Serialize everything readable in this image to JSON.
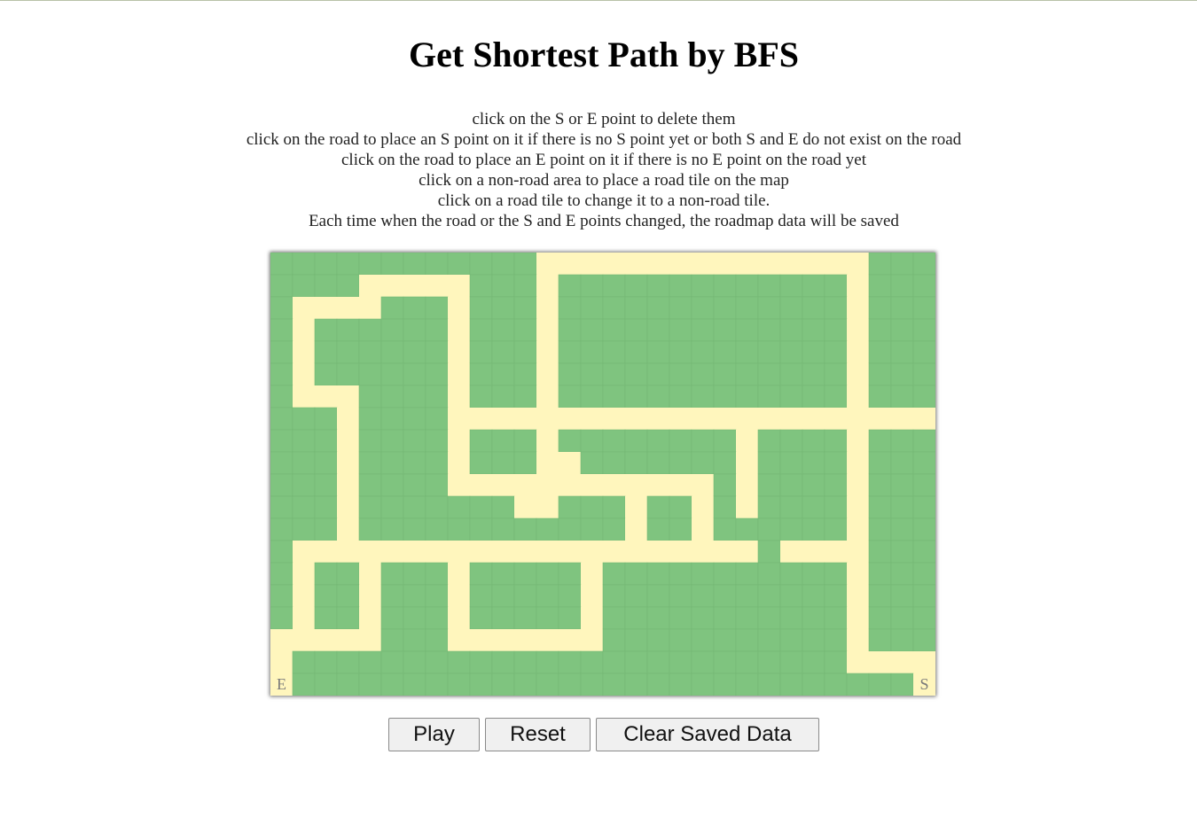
{
  "page": {
    "title": "Get Shortest Path by BFS"
  },
  "instructions": [
    "click on the S or E point to delete them",
    "click on the road to place an S point on it if there is no S point yet or both S and E do not exist on the road",
    "click on the road to place an E point on it if there is no E point on the road yet",
    "click on a non-road area to place a road tile on the map",
    "click on a road tile to change it to a non-road tile.",
    "Each time when the road or the S and E points changed, the roadmap data will be saved"
  ],
  "board": {
    "columns": 30,
    "rows": 20,
    "colors": {
      "grass": "#7fc47f",
      "road": "#fff6bd",
      "gridline": "#74b874"
    },
    "start_label": "S",
    "end_label": "E",
    "start_cell": [
      29,
      19
    ],
    "end_cell": [
      0,
      19
    ],
    "road_cells": [
      [
        12,
        0
      ],
      [
        13,
        0
      ],
      [
        14,
        0
      ],
      [
        15,
        0
      ],
      [
        16,
        0
      ],
      [
        17,
        0
      ],
      [
        18,
        0
      ],
      [
        19,
        0
      ],
      [
        20,
        0
      ],
      [
        21,
        0
      ],
      [
        22,
        0
      ],
      [
        23,
        0
      ],
      [
        24,
        0
      ],
      [
        25,
        0
      ],
      [
        26,
        0
      ],
      [
        4,
        1
      ],
      [
        5,
        1
      ],
      [
        6,
        1
      ],
      [
        7,
        1
      ],
      [
        8,
        1
      ],
      [
        12,
        1
      ],
      [
        26,
        1
      ],
      [
        1,
        2
      ],
      [
        2,
        2
      ],
      [
        3,
        2
      ],
      [
        4,
        2
      ],
      [
        8,
        2
      ],
      [
        12,
        2
      ],
      [
        26,
        2
      ],
      [
        1,
        3
      ],
      [
        8,
        3
      ],
      [
        12,
        3
      ],
      [
        26,
        3
      ],
      [
        1,
        4
      ],
      [
        8,
        4
      ],
      [
        12,
        4
      ],
      [
        26,
        4
      ],
      [
        1,
        5
      ],
      [
        8,
        5
      ],
      [
        12,
        5
      ],
      [
        26,
        5
      ],
      [
        1,
        6
      ],
      [
        2,
        6
      ],
      [
        3,
        6
      ],
      [
        8,
        6
      ],
      [
        12,
        6
      ],
      [
        26,
        6
      ],
      [
        3,
        7
      ],
      [
        8,
        7
      ],
      [
        9,
        7
      ],
      [
        10,
        7
      ],
      [
        11,
        7
      ],
      [
        12,
        7
      ],
      [
        13,
        7
      ],
      [
        14,
        7
      ],
      [
        15,
        7
      ],
      [
        16,
        7
      ],
      [
        17,
        7
      ],
      [
        18,
        7
      ],
      [
        19,
        7
      ],
      [
        20,
        7
      ],
      [
        21,
        7
      ],
      [
        22,
        7
      ],
      [
        23,
        7
      ],
      [
        24,
        7
      ],
      [
        25,
        7
      ],
      [
        26,
        7
      ],
      [
        27,
        7
      ],
      [
        28,
        7
      ],
      [
        29,
        7
      ],
      [
        3,
        8
      ],
      [
        8,
        8
      ],
      [
        12,
        8
      ],
      [
        21,
        8
      ],
      [
        26,
        8
      ],
      [
        3,
        9
      ],
      [
        8,
        9
      ],
      [
        12,
        9
      ],
      [
        13,
        9
      ],
      [
        21,
        9
      ],
      [
        26,
        9
      ],
      [
        3,
        10
      ],
      [
        8,
        10
      ],
      [
        9,
        10
      ],
      [
        10,
        10
      ],
      [
        11,
        10
      ],
      [
        12,
        10
      ],
      [
        13,
        10
      ],
      [
        14,
        10
      ],
      [
        15,
        10
      ],
      [
        16,
        10
      ],
      [
        17,
        10
      ],
      [
        18,
        10
      ],
      [
        19,
        10
      ],
      [
        21,
        10
      ],
      [
        26,
        10
      ],
      [
        3,
        11
      ],
      [
        11,
        11
      ],
      [
        12,
        11
      ],
      [
        16,
        11
      ],
      [
        19,
        11
      ],
      [
        21,
        11
      ],
      [
        26,
        11
      ],
      [
        3,
        12
      ],
      [
        16,
        12
      ],
      [
        19,
        12
      ],
      [
        26,
        12
      ],
      [
        1,
        13
      ],
      [
        2,
        13
      ],
      [
        3,
        13
      ],
      [
        4,
        13
      ],
      [
        5,
        13
      ],
      [
        6,
        13
      ],
      [
        7,
        13
      ],
      [
        8,
        13
      ],
      [
        9,
        13
      ],
      [
        10,
        13
      ],
      [
        11,
        13
      ],
      [
        12,
        13
      ],
      [
        13,
        13
      ],
      [
        14,
        13
      ],
      [
        15,
        13
      ],
      [
        16,
        13
      ],
      [
        17,
        13
      ],
      [
        18,
        13
      ],
      [
        19,
        13
      ],
      [
        20,
        13
      ],
      [
        21,
        13
      ],
      [
        23,
        13
      ],
      [
        24,
        13
      ],
      [
        25,
        13
      ],
      [
        26,
        13
      ],
      [
        1,
        14
      ],
      [
        4,
        14
      ],
      [
        8,
        14
      ],
      [
        14,
        14
      ],
      [
        26,
        14
      ],
      [
        1,
        15
      ],
      [
        4,
        15
      ],
      [
        8,
        15
      ],
      [
        14,
        15
      ],
      [
        26,
        15
      ],
      [
        1,
        16
      ],
      [
        4,
        16
      ],
      [
        8,
        16
      ],
      [
        14,
        16
      ],
      [
        26,
        16
      ],
      [
        0,
        17
      ],
      [
        1,
        17
      ],
      [
        2,
        17
      ],
      [
        3,
        17
      ],
      [
        4,
        17
      ],
      [
        8,
        17
      ],
      [
        9,
        17
      ],
      [
        10,
        17
      ],
      [
        11,
        17
      ],
      [
        12,
        17
      ],
      [
        13,
        17
      ],
      [
        14,
        17
      ],
      [
        26,
        17
      ],
      [
        0,
        18
      ],
      [
        26,
        18
      ],
      [
        27,
        18
      ],
      [
        28,
        18
      ],
      [
        29,
        18
      ],
      [
        0,
        19
      ],
      [
        29,
        19
      ]
    ]
  },
  "controls": {
    "play_label": "Play",
    "reset_label": "Reset",
    "clear_label": "Clear Saved Data"
  }
}
